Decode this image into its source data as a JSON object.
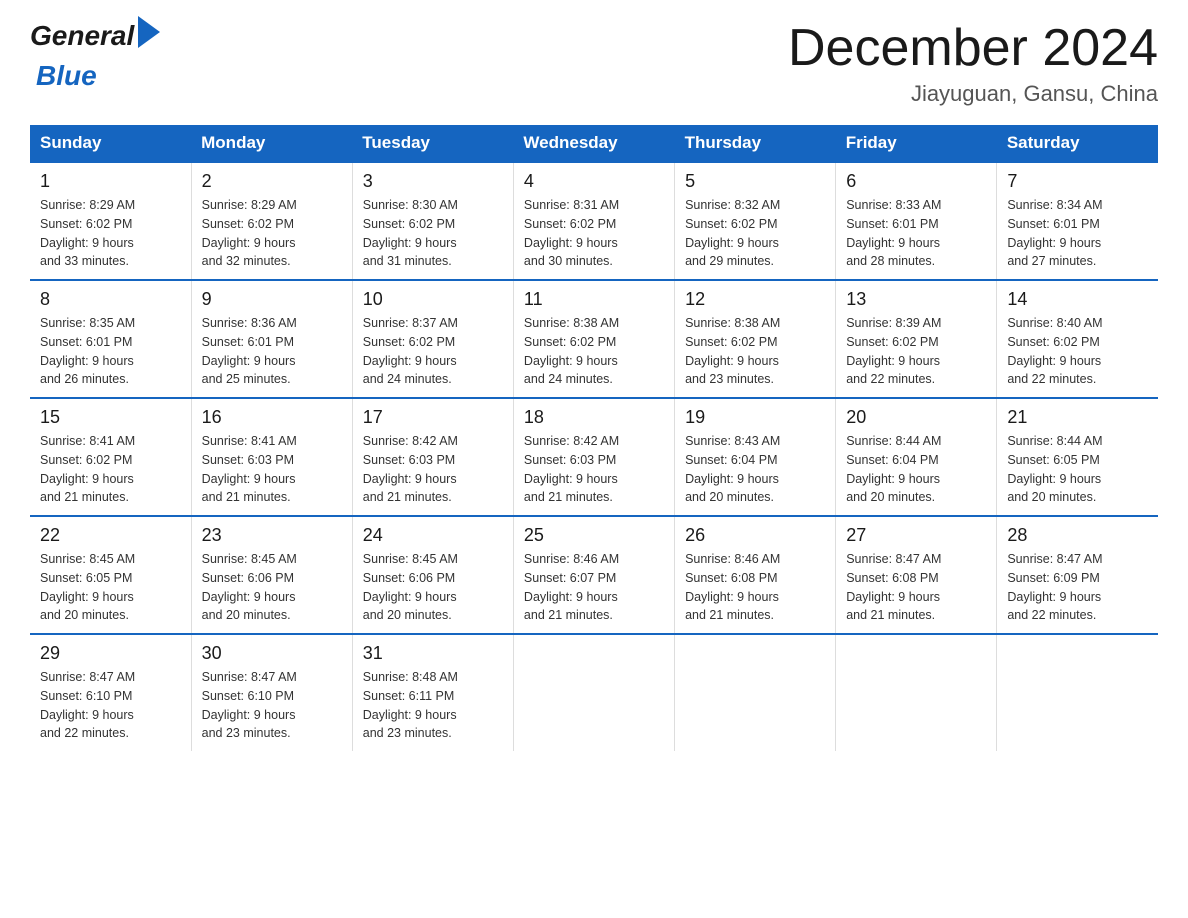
{
  "header": {
    "logo_general": "General",
    "logo_blue": "Blue",
    "month_title": "December 2024",
    "location": "Jiayuguan, Gansu, China"
  },
  "weekdays": [
    "Sunday",
    "Monday",
    "Tuesday",
    "Wednesday",
    "Thursday",
    "Friday",
    "Saturday"
  ],
  "weeks": [
    [
      {
        "day": "1",
        "sunrise": "8:29 AM",
        "sunset": "6:02 PM",
        "daylight": "9 hours and 33 minutes."
      },
      {
        "day": "2",
        "sunrise": "8:29 AM",
        "sunset": "6:02 PM",
        "daylight": "9 hours and 32 minutes."
      },
      {
        "day": "3",
        "sunrise": "8:30 AM",
        "sunset": "6:02 PM",
        "daylight": "9 hours and 31 minutes."
      },
      {
        "day": "4",
        "sunrise": "8:31 AM",
        "sunset": "6:02 PM",
        "daylight": "9 hours and 30 minutes."
      },
      {
        "day": "5",
        "sunrise": "8:32 AM",
        "sunset": "6:02 PM",
        "daylight": "9 hours and 29 minutes."
      },
      {
        "day": "6",
        "sunrise": "8:33 AM",
        "sunset": "6:01 PM",
        "daylight": "9 hours and 28 minutes."
      },
      {
        "day": "7",
        "sunrise": "8:34 AM",
        "sunset": "6:01 PM",
        "daylight": "9 hours and 27 minutes."
      }
    ],
    [
      {
        "day": "8",
        "sunrise": "8:35 AM",
        "sunset": "6:01 PM",
        "daylight": "9 hours and 26 minutes."
      },
      {
        "day": "9",
        "sunrise": "8:36 AM",
        "sunset": "6:01 PM",
        "daylight": "9 hours and 25 minutes."
      },
      {
        "day": "10",
        "sunrise": "8:37 AM",
        "sunset": "6:02 PM",
        "daylight": "9 hours and 24 minutes."
      },
      {
        "day": "11",
        "sunrise": "8:38 AM",
        "sunset": "6:02 PM",
        "daylight": "9 hours and 24 minutes."
      },
      {
        "day": "12",
        "sunrise": "8:38 AM",
        "sunset": "6:02 PM",
        "daylight": "9 hours and 23 minutes."
      },
      {
        "day": "13",
        "sunrise": "8:39 AM",
        "sunset": "6:02 PM",
        "daylight": "9 hours and 22 minutes."
      },
      {
        "day": "14",
        "sunrise": "8:40 AM",
        "sunset": "6:02 PM",
        "daylight": "9 hours and 22 minutes."
      }
    ],
    [
      {
        "day": "15",
        "sunrise": "8:41 AM",
        "sunset": "6:02 PM",
        "daylight": "9 hours and 21 minutes."
      },
      {
        "day": "16",
        "sunrise": "8:41 AM",
        "sunset": "6:03 PM",
        "daylight": "9 hours and 21 minutes."
      },
      {
        "day": "17",
        "sunrise": "8:42 AM",
        "sunset": "6:03 PM",
        "daylight": "9 hours and 21 minutes."
      },
      {
        "day": "18",
        "sunrise": "8:42 AM",
        "sunset": "6:03 PM",
        "daylight": "9 hours and 21 minutes."
      },
      {
        "day": "19",
        "sunrise": "8:43 AM",
        "sunset": "6:04 PM",
        "daylight": "9 hours and 20 minutes."
      },
      {
        "day": "20",
        "sunrise": "8:44 AM",
        "sunset": "6:04 PM",
        "daylight": "9 hours and 20 minutes."
      },
      {
        "day": "21",
        "sunrise": "8:44 AM",
        "sunset": "6:05 PM",
        "daylight": "9 hours and 20 minutes."
      }
    ],
    [
      {
        "day": "22",
        "sunrise": "8:45 AM",
        "sunset": "6:05 PM",
        "daylight": "9 hours and 20 minutes."
      },
      {
        "day": "23",
        "sunrise": "8:45 AM",
        "sunset": "6:06 PM",
        "daylight": "9 hours and 20 minutes."
      },
      {
        "day": "24",
        "sunrise": "8:45 AM",
        "sunset": "6:06 PM",
        "daylight": "9 hours and 20 minutes."
      },
      {
        "day": "25",
        "sunrise": "8:46 AM",
        "sunset": "6:07 PM",
        "daylight": "9 hours and 21 minutes."
      },
      {
        "day": "26",
        "sunrise": "8:46 AM",
        "sunset": "6:08 PM",
        "daylight": "9 hours and 21 minutes."
      },
      {
        "day": "27",
        "sunrise": "8:47 AM",
        "sunset": "6:08 PM",
        "daylight": "9 hours and 21 minutes."
      },
      {
        "day": "28",
        "sunrise": "8:47 AM",
        "sunset": "6:09 PM",
        "daylight": "9 hours and 22 minutes."
      }
    ],
    [
      {
        "day": "29",
        "sunrise": "8:47 AM",
        "sunset": "6:10 PM",
        "daylight": "9 hours and 22 minutes."
      },
      {
        "day": "30",
        "sunrise": "8:47 AM",
        "sunset": "6:10 PM",
        "daylight": "9 hours and 23 minutes."
      },
      {
        "day": "31",
        "sunrise": "8:48 AM",
        "sunset": "6:11 PM",
        "daylight": "9 hours and 23 minutes."
      },
      null,
      null,
      null,
      null
    ]
  ],
  "labels": {
    "sunrise": "Sunrise:",
    "sunset": "Sunset:",
    "daylight": "Daylight:"
  }
}
